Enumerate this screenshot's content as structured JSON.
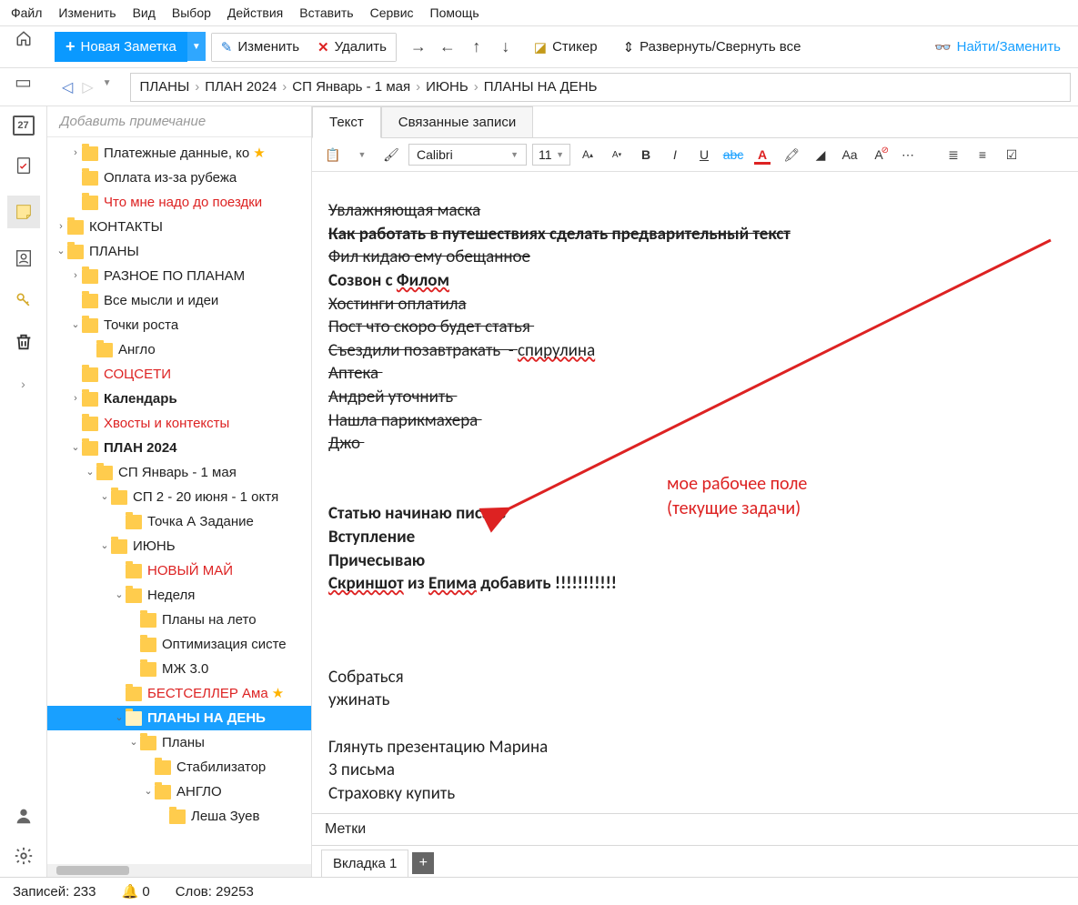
{
  "menu": [
    "Файл",
    "Изменить",
    "Вид",
    "Выбор",
    "Действия",
    "Вставить",
    "Сервис",
    "Помощь"
  ],
  "toolbar": {
    "new": "Новая Заметка",
    "edit": "Изменить",
    "delete": "Удалить",
    "sticker": "Стикер",
    "expand": "Развернуть/Свернуть все",
    "find": "Найти/Заменить"
  },
  "breadcrumb": [
    "ПЛАНЫ",
    "ПЛАН 2024",
    "СП Январь - 1 мая",
    "ИЮНЬ",
    "ПЛАНЫ НА ДЕНЬ"
  ],
  "leftrail": {
    "cal_day": "27"
  },
  "sidebar": {
    "add_placeholder": "Добавить примечание",
    "items": [
      {
        "indent": 1,
        "tw": "›",
        "label": "Платежные данные, ко",
        "star": true
      },
      {
        "indent": 1,
        "tw": "",
        "label": "Оплата из-за рубежа"
      },
      {
        "indent": 1,
        "tw": "",
        "label": "Что мне надо до поездки",
        "cls": "red"
      },
      {
        "indent": 0,
        "tw": "›",
        "label": "КОНТАКТЫ"
      },
      {
        "indent": 0,
        "tw": "⌄",
        "label": "ПЛАНЫ"
      },
      {
        "indent": 1,
        "tw": "›",
        "label": "РАЗНОЕ ПО ПЛАНАМ"
      },
      {
        "indent": 1,
        "tw": "",
        "label": "Все мысли и идеи"
      },
      {
        "indent": 1,
        "tw": "⌄",
        "label": "Точки роста"
      },
      {
        "indent": 2,
        "tw": "",
        "label": "Англо"
      },
      {
        "indent": 1,
        "tw": "",
        "label": "СОЦСЕТИ",
        "cls": "red"
      },
      {
        "indent": 1,
        "tw": "›",
        "label": "Календарь",
        "cls": "bold"
      },
      {
        "indent": 1,
        "tw": "",
        "label": "Хвосты и контексты",
        "cls": "red"
      },
      {
        "indent": 1,
        "tw": "⌄",
        "label": "ПЛАН 2024",
        "cls": "bold"
      },
      {
        "indent": 2,
        "tw": "⌄",
        "label": "СП Январь - 1 мая"
      },
      {
        "indent": 3,
        "tw": "⌄",
        "label": "СП 2 - 20 июня - 1 октя"
      },
      {
        "indent": 4,
        "tw": "",
        "label": "Точка А Задание"
      },
      {
        "indent": 3,
        "tw": "⌄",
        "label": "ИЮНЬ"
      },
      {
        "indent": 4,
        "tw": "",
        "label": "НОВЫЙ МАЙ",
        "cls": "red"
      },
      {
        "indent": 4,
        "tw": "⌄",
        "label": "Неделя"
      },
      {
        "indent": 5,
        "tw": "",
        "label": "Планы на лето"
      },
      {
        "indent": 5,
        "tw": "",
        "label": "Оптимизация систе"
      },
      {
        "indent": 5,
        "tw": "",
        "label": "МЖ 3.0"
      },
      {
        "indent": 4,
        "tw": "",
        "label": "БЕСТСЕЛЛЕР Ама",
        "cls": "red",
        "star": true
      },
      {
        "indent": 4,
        "tw": "⌄",
        "label": "ПЛАНЫ НА ДЕНЬ",
        "cls": "bold",
        "sel": true
      },
      {
        "indent": 5,
        "tw": "⌄",
        "label": "Планы"
      },
      {
        "indent": 6,
        "tw": "",
        "label": "Стабилизатор"
      },
      {
        "indent": 6,
        "tw": "⌄",
        "label": "АНГЛО"
      },
      {
        "indent": 7,
        "tw": "",
        "label": "Леша Зуев"
      }
    ]
  },
  "content_tabs": {
    "text": "Текст",
    "linked": "Связанные записи"
  },
  "format": {
    "font": "Calibri",
    "size": "11"
  },
  "note_lines": [
    {
      "t": "Увлажняющая маска",
      "st": true
    },
    {
      "t": "Как работать в путешествиях сделать предварительный текст",
      "st": true,
      "bd": true
    },
    {
      "t": "Фил кидаю ему обещанное",
      "st": true
    },
    {
      "parts": [
        {
          "t": "Созвон с ",
          "bd": true
        },
        {
          "t": "Филом",
          "bd": true,
          "sq": true
        }
      ]
    },
    {
      "t": "Хостинги оплатила",
      "st": true
    },
    {
      "t": "Пост что скоро будет статья ",
      "st": true
    },
    {
      "parts": [
        {
          "t": "Съездили позавтракать  - ",
          "st": true
        },
        {
          "t": "спирулина",
          "st": true,
          "sq": true
        }
      ]
    },
    {
      "t": "Аптека ",
      "st": true
    },
    {
      "t": "Андрей уточнить ",
      "st": true
    },
    {
      "t": "Нашла парикмахера ",
      "st": true
    },
    {
      "t": "Джо ",
      "st": true
    },
    {
      "t": ""
    },
    {
      "t": ""
    },
    {
      "t": "Статью начинаю писать",
      "bd": true
    },
    {
      "t": "Вступление",
      "bd": true
    },
    {
      "t": "Причесываю",
      "bd": true
    },
    {
      "parts": [
        {
          "t": "Скриншот",
          "bd": true,
          "sq": true
        },
        {
          "t": " из ",
          "bd": true
        },
        {
          "t": "Епима",
          "bd": true,
          "sq": true
        },
        {
          "t": " добавить !!!!!!!!!!!",
          "bd": true
        }
      ]
    },
    {
      "t": ""
    },
    {
      "t": ""
    },
    {
      "t": ""
    },
    {
      "t": "Собраться"
    },
    {
      "t": "ужинать"
    },
    {
      "t": ""
    },
    {
      "t": "Глянуть презентацию Марина"
    },
    {
      "t": "3 письма"
    },
    {
      "t": "Страховку купить"
    }
  ],
  "annotation": {
    "l1": "мое рабочее поле",
    "l2": "(текущие задачи)"
  },
  "metki_label": "Метки",
  "bottom_tab": "Вкладка 1",
  "status": {
    "records": "Записей: 233",
    "bell": "0",
    "words": "Слов: 29253"
  }
}
